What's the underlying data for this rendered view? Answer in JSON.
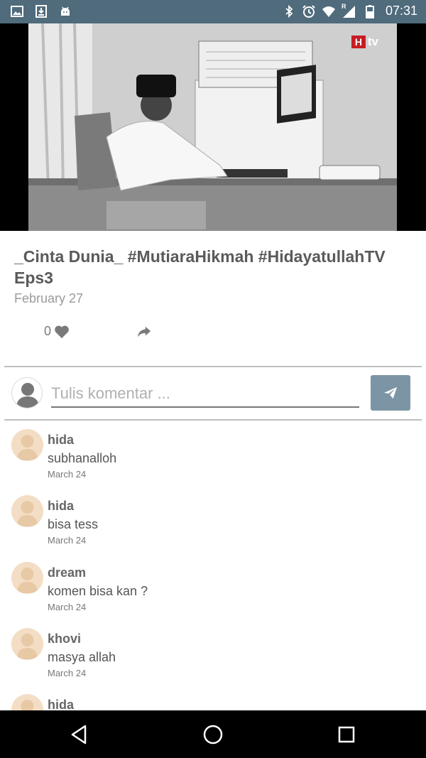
{
  "status_bar": {
    "time": "07:31",
    "left_icons": [
      "image-icon",
      "download-icon",
      "android-icon"
    ],
    "right_icons": [
      "bluetooth-icon",
      "alarm-icon",
      "wifi-icon",
      "signal-icon",
      "battery-icon"
    ],
    "signal_label": "R"
  },
  "video": {
    "logo_mark": "H",
    "logo_text": "tv"
  },
  "post": {
    "title": "_Cinta Dunia_ #MutiaraHikmah #HidayatullahTV Eps3",
    "date": "February 27",
    "like_count": "0"
  },
  "comment_box": {
    "placeholder": "Tulis komentar ..."
  },
  "comments": [
    {
      "name": "hida",
      "text": "subhanalloh",
      "date": "March 24"
    },
    {
      "name": "hida",
      "text": "bisa tess",
      "date": "March 24"
    },
    {
      "name": "dream",
      "text": "komen bisa kan ?",
      "date": "March 24"
    },
    {
      "name": "khovi",
      "text": "masya allah",
      "date": "March 24"
    },
    {
      "name": "hida",
      "text": "",
      "date": ""
    }
  ],
  "colors": {
    "status_bar": "#4f6b7c",
    "send_button": "#7c95a4",
    "avatar_skin": "#f3ddc5",
    "logo_red": "#c61d23"
  }
}
